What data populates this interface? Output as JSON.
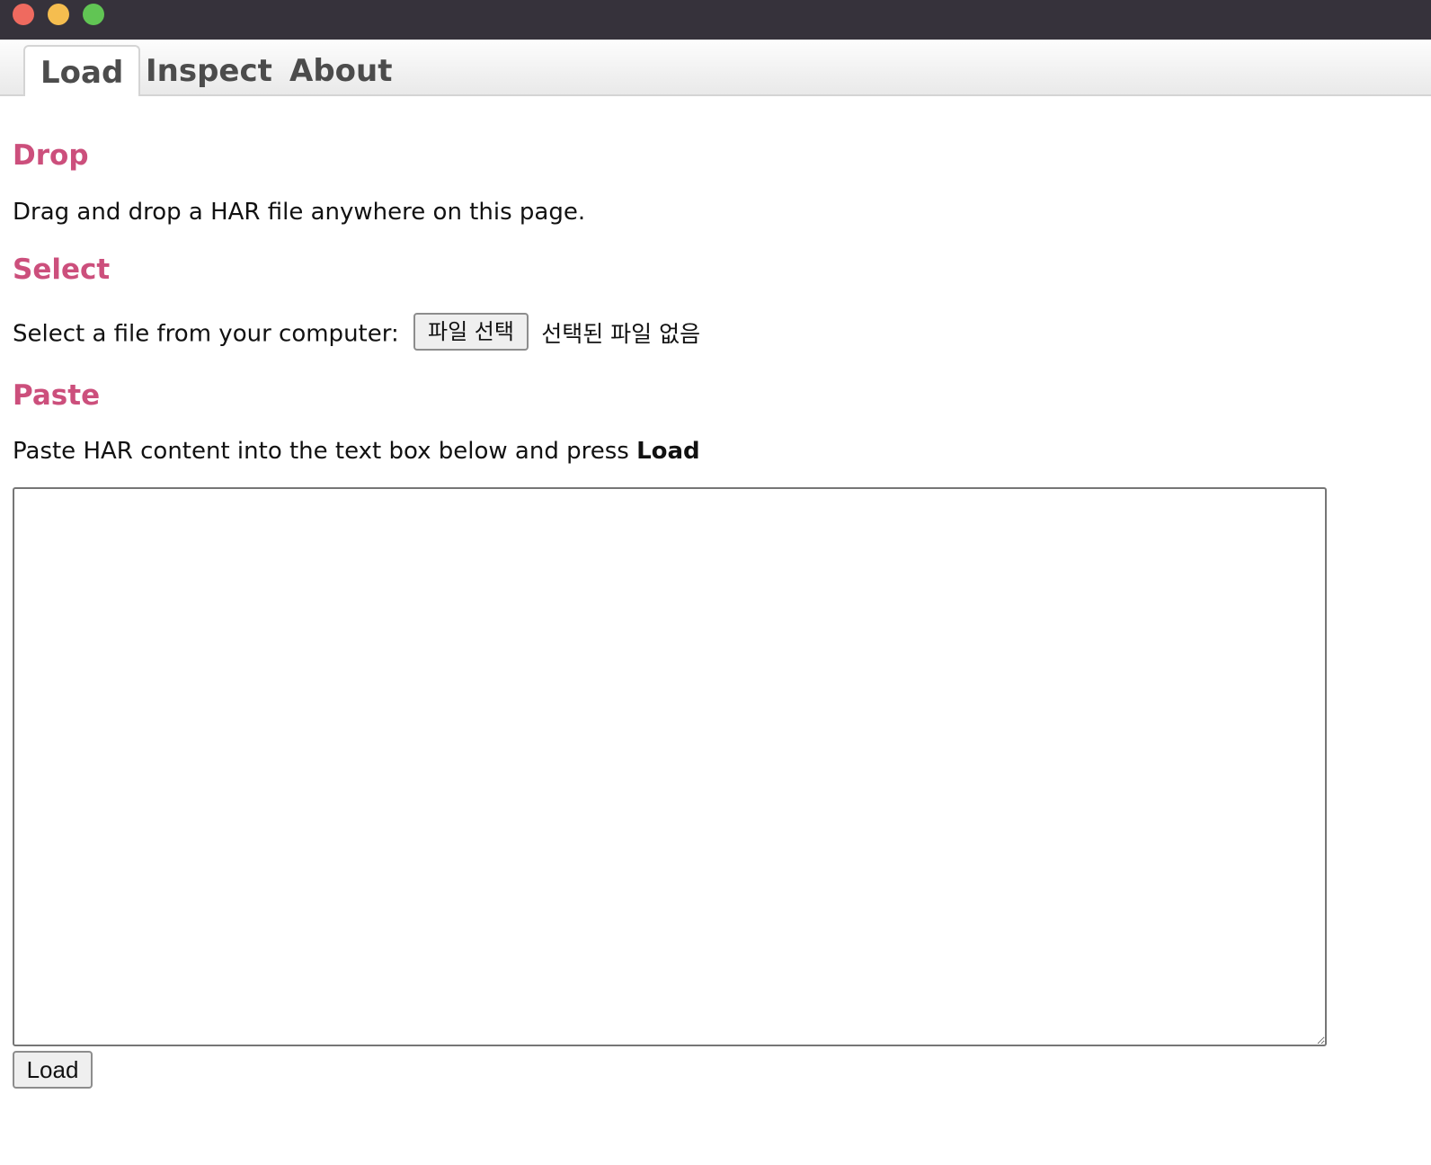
{
  "window": {
    "controls": {
      "close_color": "#ef6a5f",
      "minimize_color": "#f5bd4f",
      "maximize_color": "#61c554"
    }
  },
  "tabs": [
    {
      "label": "Load",
      "active": true
    },
    {
      "label": "Inspect",
      "active": false
    },
    {
      "label": "About",
      "active": false
    }
  ],
  "colors": {
    "heading": "#cc4f7c",
    "titlebar": "#36323b"
  },
  "drop": {
    "heading": "Drop",
    "text": "Drag and drop a HAR file anywhere on this page."
  },
  "select": {
    "heading": "Select",
    "label": "Select a file from your computer:",
    "button_label": "파일 선택",
    "status": "선택된 파일 없음"
  },
  "paste": {
    "heading": "Paste",
    "text_prefix": "Paste HAR content into the text box below and press ",
    "text_bold": "Load",
    "textarea_value": "",
    "load_button_label": "Load"
  }
}
